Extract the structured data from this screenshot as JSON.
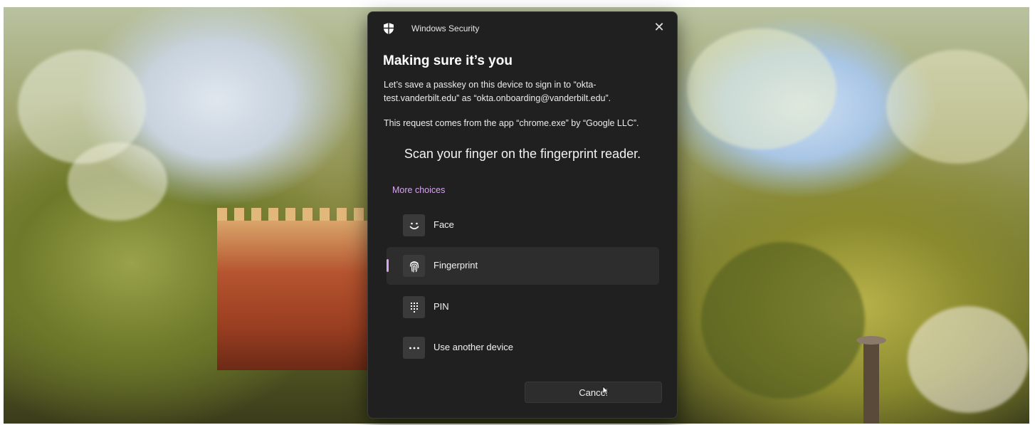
{
  "dialog": {
    "app_title": "Windows Security",
    "close_glyph": "✕",
    "heading": "Making sure it’s you",
    "description": "Let’s save a passkey on this device to sign in to “okta-test.vanderbilt.edu” as “okta.onboarding@vanderbilt.edu”.",
    "request_info": "This request comes from the app “chrome.exe” by “Google LLC”.",
    "prompt": "Scan your finger on the fingerprint reader.",
    "more_choices": "More choices",
    "options": [
      {
        "label": "Face",
        "icon": "face-icon",
        "selected": false
      },
      {
        "label": "Fingerprint",
        "icon": "fingerprint-icon",
        "selected": true
      },
      {
        "label": "PIN",
        "icon": "pin-keypad-icon",
        "selected": false
      },
      {
        "label": "Use another device",
        "icon": "more-dots-icon",
        "selected": false
      }
    ],
    "cancel_label": "Cancel"
  },
  "colors": {
    "dialog_bg": "#202020",
    "accent": "#d7a6f0",
    "selected_row": "#2d2d2d",
    "icon_tile": "#3a3a3a"
  }
}
